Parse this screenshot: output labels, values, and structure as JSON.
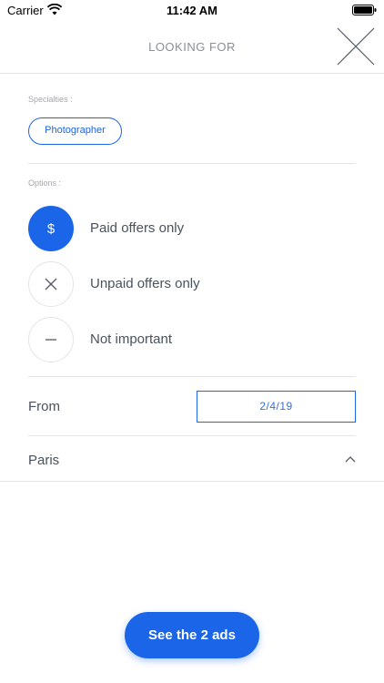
{
  "status_bar": {
    "carrier": "Carrier",
    "time": "11:42 AM"
  },
  "header": {
    "title": "LOOKING FOR"
  },
  "specialties": {
    "label": "Specialties :",
    "chips": [
      "Photographer"
    ]
  },
  "options": {
    "label": "Options :",
    "items": [
      {
        "label": "Paid offers only",
        "symbol": "$",
        "selected": true
      },
      {
        "label": "Unpaid offers only",
        "symbol": "×",
        "selected": false
      },
      {
        "label": "Not important",
        "symbol": "–",
        "selected": false
      }
    ]
  },
  "from": {
    "label": "From",
    "date": "2/4/19"
  },
  "location": {
    "city": "Paris"
  },
  "cta": {
    "label": "See the 2 ads"
  },
  "colors": {
    "accent": "#1b66e8",
    "divider": "#e3e5e8"
  }
}
